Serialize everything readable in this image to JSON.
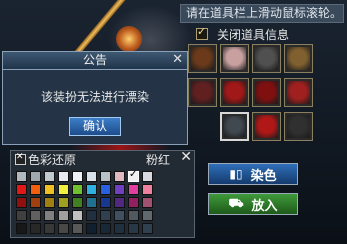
{
  "hint_bar": {
    "text": "请在道具栏上滑动鼠标滚轮。"
  },
  "close_item_info": {
    "label": "关闭道具信息",
    "checked": true
  },
  "equipment_slots": [
    {
      "icon": "wing-icon",
      "color": "#6a3a1a"
    },
    {
      "icon": "hair-icon",
      "color": "#c8a0a0"
    },
    {
      "icon": "helmet-icon",
      "color": "#505050"
    },
    {
      "icon": "ornament-icon",
      "color": "#806030"
    },
    {
      "icon": "face-icon",
      "color": "#602020"
    },
    {
      "icon": "dress-icon",
      "color": "#a01818"
    },
    {
      "icon": "boots-icon",
      "color": "#801010"
    },
    {
      "icon": "skirt-icon",
      "color": "#a02020"
    },
    {
      "icon": "glove-icon",
      "color": "#404850"
    },
    {
      "icon": "sleeve-icon",
      "color": "#b01818"
    },
    {
      "icon": "tail-icon",
      "color": "#303030"
    }
  ],
  "notice": {
    "title": "公告",
    "message": "该装扮无法进行漂染",
    "ok_label": "确认"
  },
  "palette": {
    "restore_label": "色彩还原",
    "selected_name": "粉红",
    "rows": [
      [
        "#b0b8c0",
        "#a0a8b0",
        "#c0c8d0",
        "#e8e8f0",
        "#f0f0f8",
        "#d8e0e8",
        "#b8c0c8",
        "#e0b8c0",
        "#f0f0f0",
        "#d8d8e0"
      ],
      [
        "#e01818",
        "#f06010",
        "#f0c020",
        "#f0f040",
        "#70c030",
        "#30b0e0",
        "#2860e0",
        "#7040c0",
        "#e040a0",
        "#f080a0"
      ],
      [
        "#901010",
        "#a04010",
        "#a08010",
        "#a0a020",
        "#408020",
        "#207090",
        "#183890",
        "#502880",
        "#902060",
        "#a05070"
      ],
      [
        "#404040",
        "#606060",
        "#808080",
        "#a0a0a0",
        "#c0c0c0",
        "#203040",
        "#304050",
        "#405060",
        "#505860",
        "#606870"
      ],
      [
        "#181818",
        "#282828",
        "#383838",
        "#484848",
        "#585858",
        "#102030",
        "#182838",
        "#203040",
        "#283848",
        "#304050"
      ]
    ],
    "selected_index": [
      0,
      8
    ]
  },
  "buttons": {
    "dye_label": "染色",
    "put_label": "放入"
  }
}
